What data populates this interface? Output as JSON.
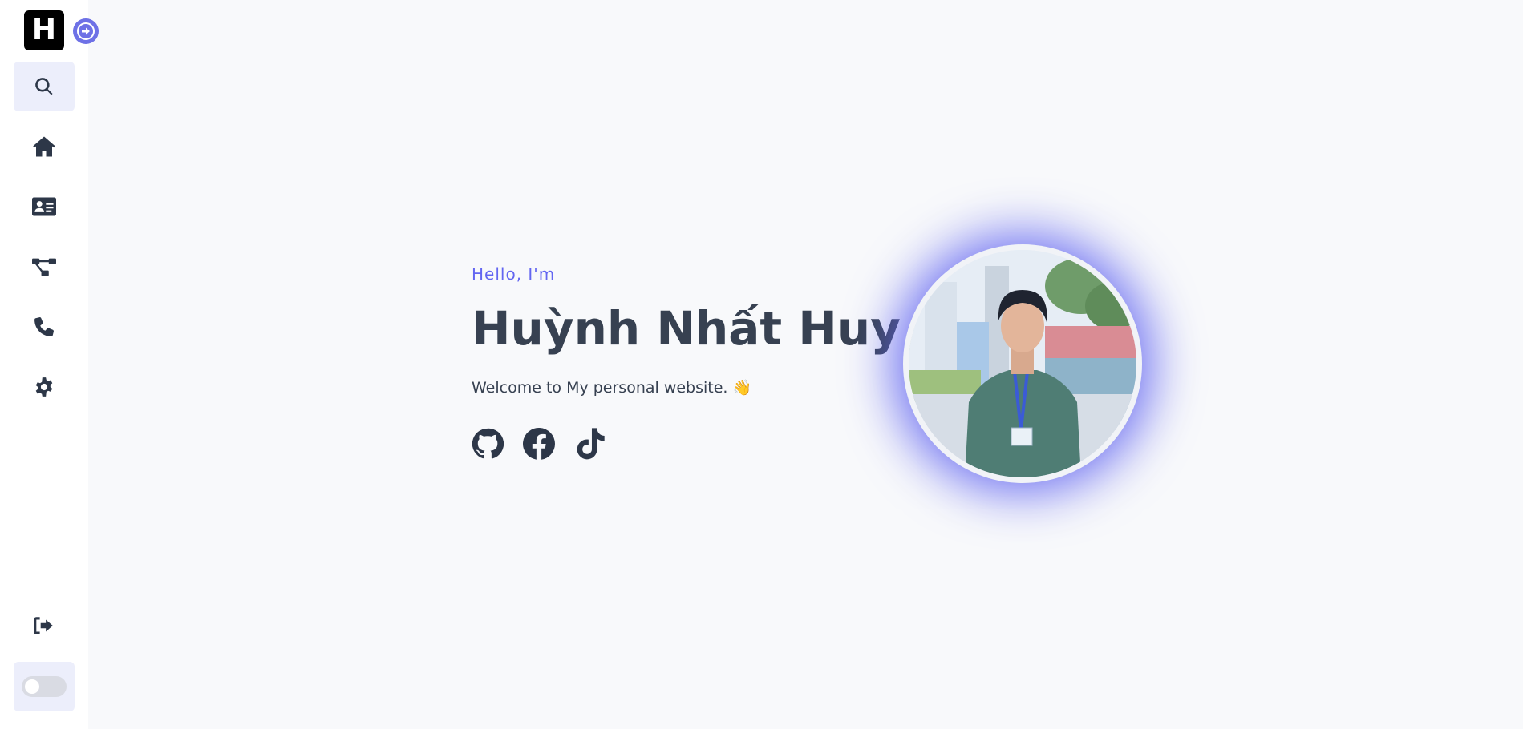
{
  "sidebar": {
    "logo_text": "H",
    "items": [
      {
        "icon": "search-icon",
        "active": true
      },
      {
        "icon": "home-icon",
        "active": false
      },
      {
        "icon": "id-card-icon",
        "active": false
      },
      {
        "icon": "project-diagram-icon",
        "active": false
      },
      {
        "icon": "phone-icon",
        "active": false
      },
      {
        "icon": "gear-icon",
        "active": false
      }
    ],
    "logout_icon": "sign-out-icon",
    "theme_toggle": {
      "on": false
    }
  },
  "hero": {
    "greeting": "Hello, I'm",
    "name": "Huỳnh Nhất Huy",
    "tagline": "Welcome to My personal website. 👋",
    "socials": [
      "github-icon",
      "facebook-icon",
      "tiktok-icon"
    ]
  },
  "colors": {
    "accent": "#6366f1",
    "text": "#374151",
    "background": "#f8f9fb"
  }
}
